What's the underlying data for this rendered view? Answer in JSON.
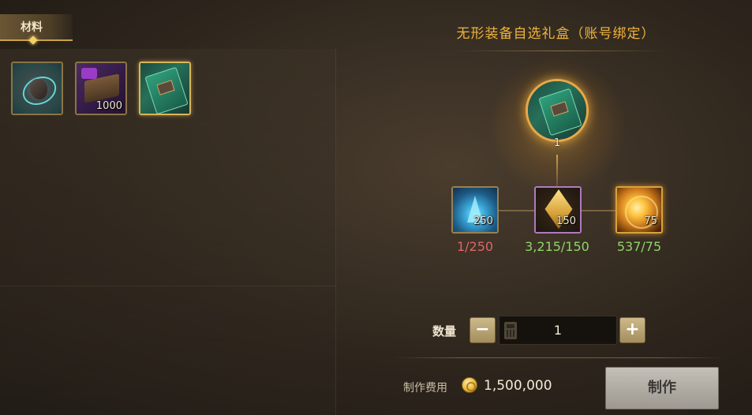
{
  "materials_panel": {
    "tab_label": "材料",
    "items": [
      {
        "icon": "orbit-ore-icon",
        "quantity": ""
      },
      {
        "icon": "purple-book-icon",
        "quantity": "1000"
      },
      {
        "icon": "green-card-icon",
        "quantity": ""
      }
    ]
  },
  "recipe": {
    "title": "无形装备自选礼盒（账号绑定）",
    "result": {
      "icon": "green-card-icon",
      "quantity": "1"
    },
    "requirements": [
      {
        "icon": "blue-crystal-icon",
        "amount": "250",
        "progress": "1/250",
        "status": "insufficient"
      },
      {
        "icon": "gold-cube-icon",
        "amount": "150",
        "progress": "3,215/150",
        "status": "sufficient"
      },
      {
        "icon": "gold-sphere-icon",
        "amount": "75",
        "progress": "537/75",
        "status": "sufficient"
      }
    ]
  },
  "quantity": {
    "label": "数量",
    "minus": "−",
    "plus": "+",
    "value": "1"
  },
  "cost": {
    "label": "制作费用",
    "currency_icon": "gold-coin-icon",
    "value": "1,500,000"
  },
  "make_button": {
    "label": "制作"
  },
  "colors": {
    "title": "#f0b43c",
    "insufficient": "#e0646a",
    "sufficient": "#8fd66a"
  }
}
